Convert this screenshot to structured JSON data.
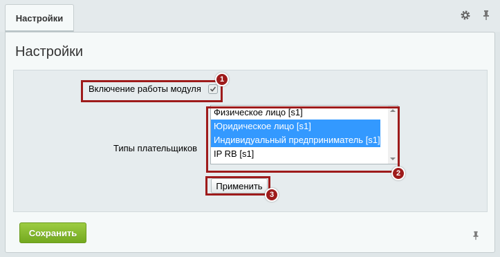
{
  "tab": {
    "label": "Настройки"
  },
  "page": {
    "title": "Настройки"
  },
  "form": {
    "enable_label": "Включение работы модуля",
    "enable_checked": true,
    "payer_types_label": "Типы плательщиков",
    "payer_types": [
      {
        "label": "Физическое лицо [s1]",
        "selected": false
      },
      {
        "label": "Юридическое лицо [s1]",
        "selected": true
      },
      {
        "label": "Индивидуальный предприниматель [s1]",
        "selected": true
      },
      {
        "label": "IP RB [s1]",
        "selected": false
      }
    ],
    "apply_label": "Применить"
  },
  "footer": {
    "save_label": "Сохранить"
  },
  "annotations": [
    "1",
    "2",
    "3"
  ],
  "colors": {
    "accent_green": "#7ab32e",
    "highlight": "#9e1b1b",
    "selection": "#3399ff"
  }
}
